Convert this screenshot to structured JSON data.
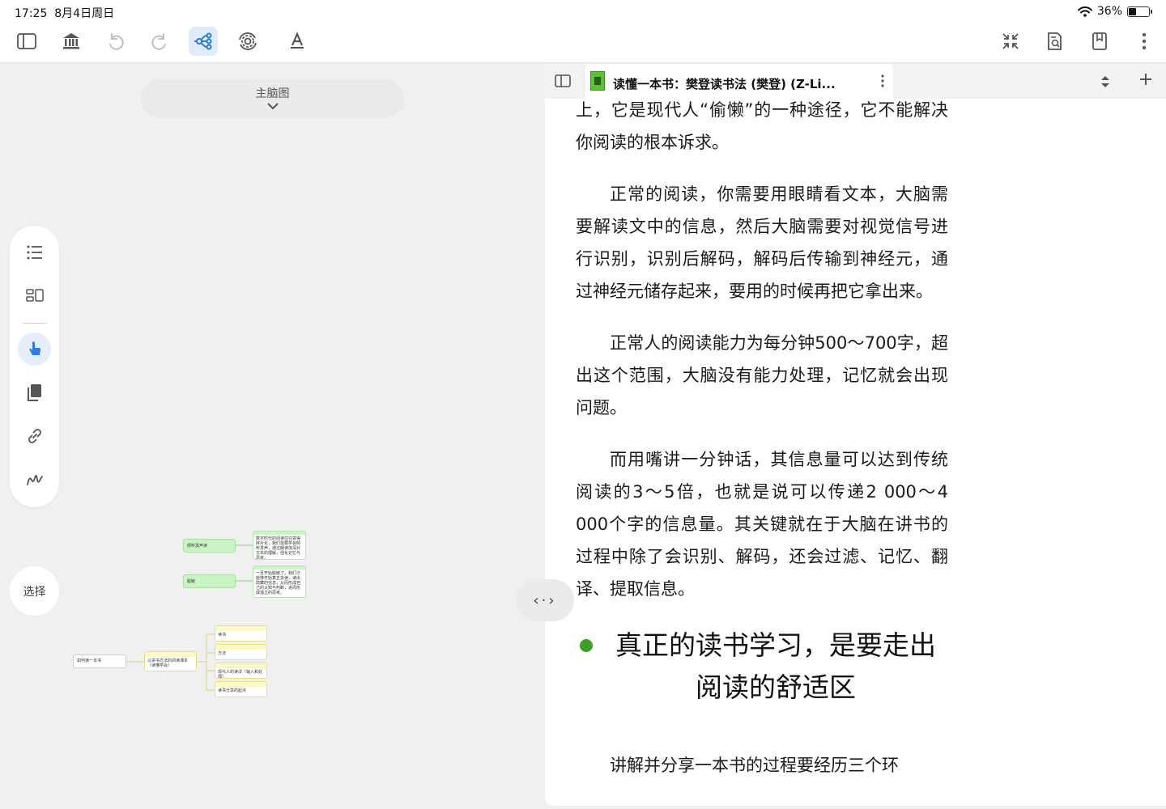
{
  "status": {
    "time": "17:25",
    "date": "8月4日周日",
    "battery_percent": "36%",
    "battery_level": 0.36
  },
  "toolbar": {
    "left_icons": [
      "sidebar-icon",
      "library-icon",
      "undo-icon",
      "redo-icon",
      "mindmap-icon",
      "refresh-gear-icon",
      "text-style-icon"
    ],
    "right_icons": [
      "collapse-icon",
      "document-search-icon",
      "bookmark-icon",
      "more-icon"
    ],
    "accent": "#2f7be0"
  },
  "canvas": {
    "map_title": "主脑图",
    "select_label": "选择",
    "side_tools": [
      "outline-icon",
      "layout-icon",
      "pointer-hand-icon",
      "copy-icon",
      "link-icon",
      "freehand-icon"
    ],
    "nodes": {
      "root": "如何读一本书",
      "branch": "以讲书方法的阅读课本（读懂学会）",
      "green_1": "倾听发声读",
      "green_2": "脱敏",
      "note_1": "数字时代的阅读往往变得碎片化，我们需要学会倾听发声，通过朗读加深对文本的理解，强化记忆与思考。",
      "note_2": "一旦开始脱敏了，我们才能够开始真正去读，读出隐藏的信息，从而形成自己的认知与判断，进而形成独立的思考。",
      "child_1": "读书",
      "child_2": "方法",
      "child_3": "现代人的读法（输入和处理）",
      "child_4": "读书分享的起点"
    }
  },
  "reader": {
    "tab_title": "读懂一本书：樊登读书法 (樊登) (Z-Li...",
    "accent_green": "#3f9e27",
    "para_0": "上，它是现代人“偷懒”的一种途径，它不能解决你阅读的根本诉求。",
    "para_1": "正常的阅读，你需要用眼睛看文本，大脑需要解读文中的信息，然后大脑需要对视觉信号进行识别，识别后解码，解码后传输到神经元，通过神经元储存起来，要用的时候再把它拿出来。",
    "para_2": "正常人的阅读能力为每分钟500～700字，超出这个范围，大脑没有能力处理，记忆就会出现问题。",
    "para_3": "而用嘴讲一分钟话，其信息量可以达到传统阅读的3～5倍，也就是说可以传递2 000～4 000个字的信息量。其关键就在于大脑在讲书的过程中除了会识别、解码，还会过滤、记忆、翻译、提取信息。",
    "heading_line1": "真正的读书学习，是要走出",
    "heading_line2": "阅读的舒适区",
    "para_4": "讲解并分享一本书的过程要经历三个环"
  }
}
